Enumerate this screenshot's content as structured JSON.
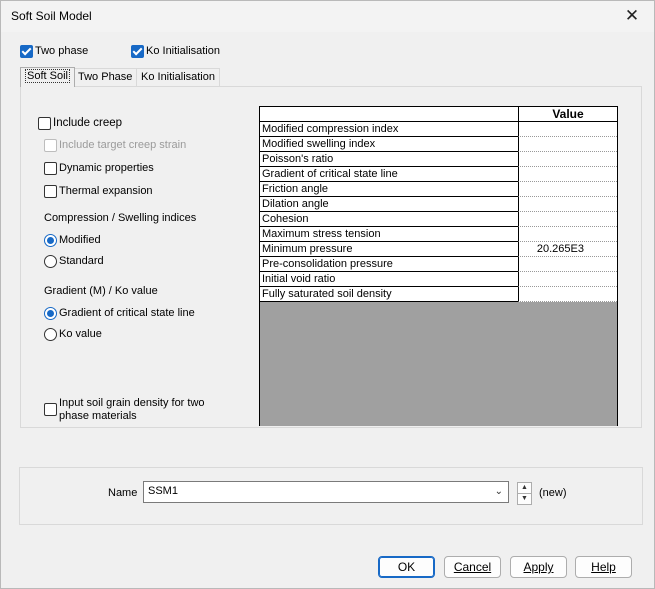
{
  "window": {
    "title": "Soft Soil Model",
    "close_glyph": "✕"
  },
  "top_options": {
    "two_phase": {
      "label": "Two phase",
      "checked": true
    },
    "ko_initialisation": {
      "label": "Ko Initialisation",
      "checked": true
    }
  },
  "tabs": [
    {
      "label": "Soft Soil",
      "active": true
    },
    {
      "label": "Two Phase",
      "active": false
    },
    {
      "label": "Ko Initialisation",
      "active": false
    }
  ],
  "options": {
    "include_creep": "Include creep",
    "include_target_creep_strain": "Include target creep strain",
    "dynamic_properties": "Dynamic properties",
    "thermal_expansion": "Thermal expansion"
  },
  "compression": {
    "heading": "Compression / Swelling indices",
    "modified": "Modified",
    "standard": "Standard"
  },
  "gradient": {
    "heading": "Gradient (M) / Ko value",
    "gradient_csl": "Gradient of critical state line",
    "ko_value": "Ko value"
  },
  "grain_density": {
    "line1": "Input soil grain density for two",
    "line2": "phase materials"
  },
  "grid": {
    "value_header": "Value",
    "rows": [
      {
        "name": "Modified compression index",
        "value": ""
      },
      {
        "name": "Modified swelling index",
        "value": ""
      },
      {
        "name": "Poisson's ratio",
        "value": ""
      },
      {
        "name": "Gradient of critical state line",
        "value": ""
      },
      {
        "name": "Friction angle",
        "value": ""
      },
      {
        "name": "Dilation angle",
        "value": ""
      },
      {
        "name": "Cohesion",
        "value": ""
      },
      {
        "name": "Maximum stress tension",
        "value": ""
      },
      {
        "name": "Minimum pressure",
        "value": "20.265E3"
      },
      {
        "name": "Pre-consolidation pressure",
        "value": ""
      },
      {
        "name": "Initial void ratio",
        "value": ""
      },
      {
        "name": "Fully saturated soil density",
        "value": ""
      }
    ]
  },
  "name_section": {
    "label": "Name",
    "value": "SSM1",
    "status": "(new)"
  },
  "buttons": {
    "ok": "OK",
    "cancel": "Cancel",
    "apply": "Apply",
    "help": "Help"
  },
  "colors": {
    "accent": "#1769c6",
    "background": "#f0f0f0"
  }
}
